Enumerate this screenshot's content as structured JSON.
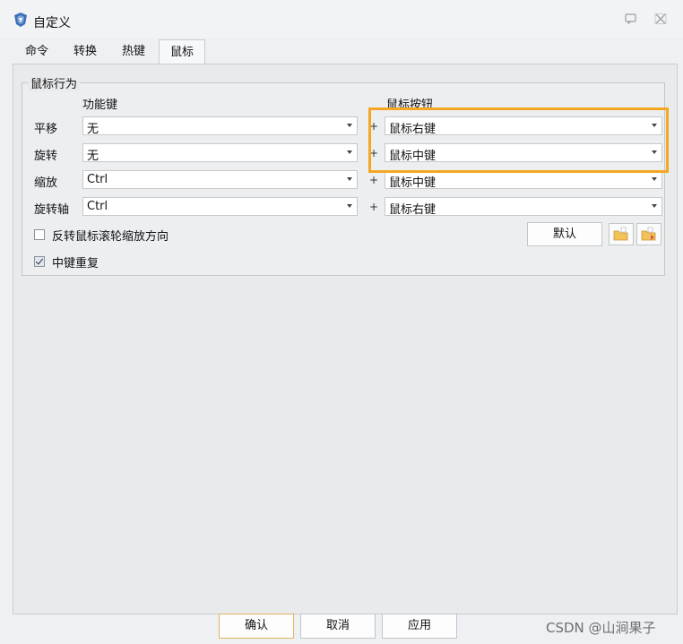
{
  "window": {
    "title": "自定义",
    "minimize_icon": "restore-icon",
    "close_icon": "close-icon"
  },
  "tabs": [
    {
      "label": "命令"
    },
    {
      "label": "转换"
    },
    {
      "label": "热键"
    },
    {
      "label": "鼠标",
      "active": true
    }
  ],
  "mouse_group": {
    "title": "鼠标行为",
    "modifier_header": "功能键",
    "button_header": "鼠标按钮",
    "rows": [
      {
        "label": "平移",
        "modifier": "无",
        "plus": "+",
        "button": "鼠标右键"
      },
      {
        "label": "旋转",
        "modifier": "无",
        "plus": "+",
        "button": "鼠标中键"
      },
      {
        "label": "缩放",
        "modifier": "Ctrl",
        "plus": "+",
        "button": "鼠标中键"
      },
      {
        "label": "旋转轴",
        "modifier": "Ctrl",
        "plus": "+",
        "button": "鼠标右键"
      }
    ],
    "reverse_wheel": {
      "label": "反转鼠标滚轮缩放方向",
      "checked": false
    },
    "middle_repeat": {
      "label": "中键重复",
      "checked": true
    },
    "default_button": "默认"
  },
  "footer": {
    "ok": "确认",
    "cancel": "取消",
    "apply": "应用"
  },
  "watermark": "CSDN @山涧果子",
  "colors": {
    "highlight": "#f5a623"
  }
}
